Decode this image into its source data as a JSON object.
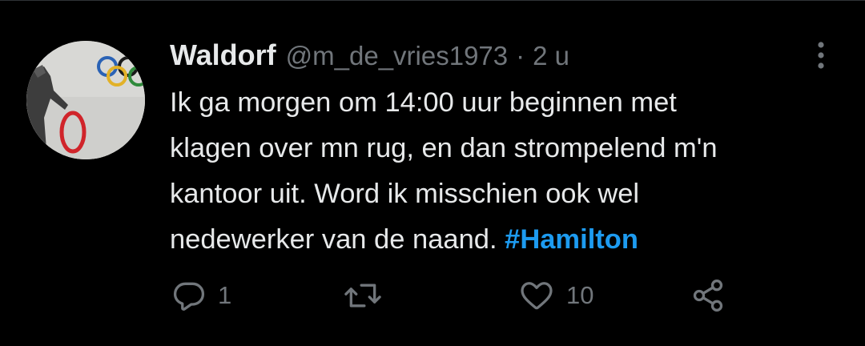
{
  "tweet": {
    "display_name": "Waldorf",
    "handle": "@m_de_vries1973",
    "separator": "·",
    "time": "2 u",
    "body_lines": [
      "Ik ga morgen om 14:00 uur beginnen met",
      "klagen over mn rug, en dan strompelend m'n",
      "kantoor uit. Word ik misschien ook wel"
    ],
    "last_line_text": "nedewerker van de naand.",
    "hashtag": "#Hamilton"
  },
  "actions": {
    "reply_count": "1",
    "like_count": "10"
  },
  "icons": {
    "more": "more-vertical-icon",
    "reply": "reply-icon",
    "retweet": "retweet-icon",
    "like": "heart-icon",
    "share": "share-icon"
  },
  "colors": {
    "background": "#000000",
    "text": "#e7e9ea",
    "muted": "#71767b",
    "hashtag": "#1d9bf0"
  }
}
